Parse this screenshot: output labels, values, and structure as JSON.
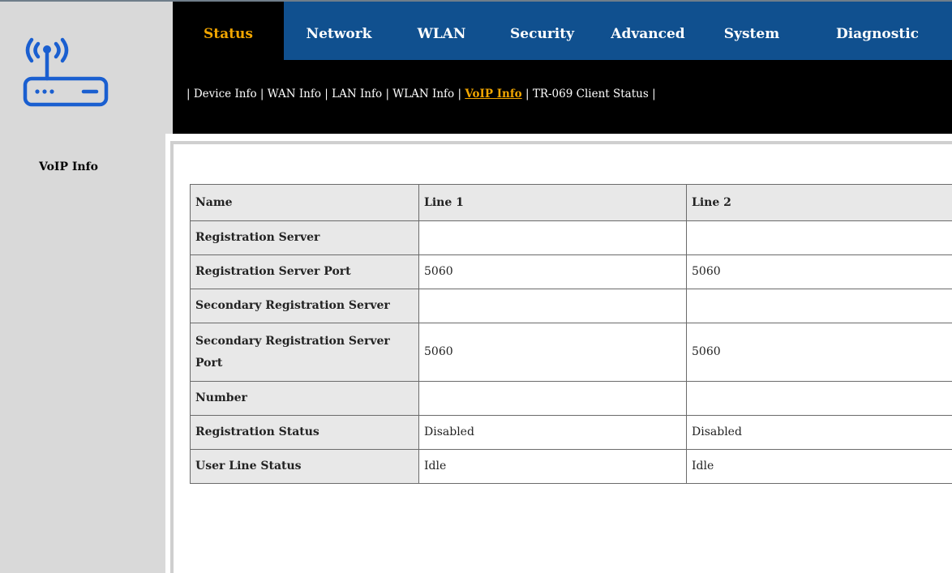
{
  "brand": {
    "logo_icon": "wifi-router-icon",
    "logo_color": "#1a5fd0"
  },
  "colors": {
    "nav_bg": "#10508f",
    "nav_active_text": "#f2a600",
    "header_bg": "#000000",
    "sidebar_bg": "#d9d9d9"
  },
  "nav": {
    "items": [
      {
        "label": "Status",
        "active": true
      },
      {
        "label": "Network",
        "active": false
      },
      {
        "label": "WLAN",
        "active": false
      },
      {
        "label": "Security",
        "active": false
      },
      {
        "label": "Advanced",
        "active": false
      },
      {
        "label": "System",
        "active": false
      },
      {
        "label": "Diagnostic",
        "active": false
      }
    ]
  },
  "subnav": {
    "items": [
      {
        "label": "Device Info",
        "active": false
      },
      {
        "label": "WAN Info",
        "active": false
      },
      {
        "label": "LAN Info",
        "active": false
      },
      {
        "label": "WLAN Info",
        "active": false
      },
      {
        "label": "VoIP Info",
        "active": true
      },
      {
        "label": "TR-069 Client Status",
        "active": false
      }
    ]
  },
  "sidebar": {
    "items": [
      {
        "label": "VoIP Info"
      }
    ]
  },
  "table": {
    "headers": [
      "Name",
      "Line 1",
      "Line 2"
    ],
    "rows": [
      {
        "name": "Registration Server",
        "line1": "",
        "line2": ""
      },
      {
        "name": "Registration Server Port",
        "line1": "5060",
        "line2": "5060"
      },
      {
        "name": "Secondary Registration Server",
        "line1": "",
        "line2": ""
      },
      {
        "name": "Secondary Registration Server Port",
        "line1": "5060",
        "line2": "5060"
      },
      {
        "name": "Number",
        "line1": "",
        "line2": ""
      },
      {
        "name": "Registration Status",
        "line1": "Disabled",
        "line2": "Disabled"
      },
      {
        "name": "User Line Status",
        "line1": "Idle",
        "line2": "Idle"
      }
    ]
  }
}
